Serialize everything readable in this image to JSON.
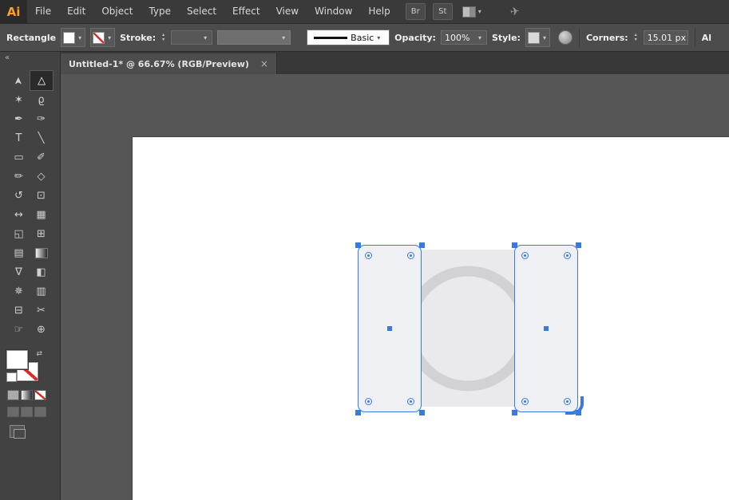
{
  "app": {
    "logo": "Ai"
  },
  "glyphs": {
    "caret": "▾",
    "stepper_up": "▴",
    "stepper_down": "▾",
    "swap": "⇄",
    "collapse": "«",
    "close": "×",
    "plane": "✈"
  },
  "menubar": {
    "items": [
      "File",
      "Edit",
      "Object",
      "Type",
      "Select",
      "Effect",
      "View",
      "Window",
      "Help"
    ],
    "brush_libraries_label": "Br",
    "graphic_styles_label": "St"
  },
  "control_bar": {
    "tool_label": "Rectangle",
    "stroke_label": "Stroke:",
    "stroke_style_value": "Basic",
    "opacity_label": "Opacity:",
    "opacity_value": "100%",
    "style_label": "Style:",
    "corners_label": "Corners:",
    "corners_value": "15.01 px",
    "right_truncated": "Al"
  },
  "document_tab": {
    "title": "Untitled-1* @ 66.67% (RGB/Preview)"
  },
  "tools": [
    {
      "name": "selection",
      "glyph": "➤",
      "cls": "up"
    },
    {
      "name": "direct-selection",
      "glyph": "▷",
      "cls": "up",
      "active": true
    },
    {
      "name": "magic-wand",
      "glyph": "✶"
    },
    {
      "name": "lasso",
      "glyph": "ϱ"
    },
    {
      "name": "pen",
      "glyph": "✒"
    },
    {
      "name": "curvature",
      "glyph": "✑"
    },
    {
      "name": "type",
      "glyph": "T"
    },
    {
      "name": "line-segment",
      "glyph": "╲"
    },
    {
      "name": "rectangle",
      "glyph": "▭"
    },
    {
      "name": "paintbrush",
      "glyph": "✐"
    },
    {
      "name": "pencil",
      "glyph": "✏"
    },
    {
      "name": "eraser",
      "glyph": "◇"
    },
    {
      "name": "rotate",
      "glyph": "↺"
    },
    {
      "name": "scale",
      "glyph": "⊡"
    },
    {
      "name": "width",
      "glyph": "↔"
    },
    {
      "name": "free-transform",
      "glyph": "▦"
    },
    {
      "name": "shape-builder",
      "glyph": "◱"
    },
    {
      "name": "perspective-grid",
      "glyph": "⊞"
    },
    {
      "name": "mesh",
      "glyph": "▤"
    },
    {
      "name": "gradient",
      "glyph": "",
      "cls": "grad"
    },
    {
      "name": "eyedropper",
      "glyph": "∇"
    },
    {
      "name": "blend",
      "glyph": "◧"
    },
    {
      "name": "symbol-sprayer",
      "glyph": "✵"
    },
    {
      "name": "column-graph",
      "glyph": "▥"
    },
    {
      "name": "artboard",
      "glyph": "⊟"
    },
    {
      "name": "slice",
      "glyph": "✂"
    },
    {
      "name": "hand",
      "glyph": "☞"
    },
    {
      "name": "zoom",
      "glyph": "⊕"
    }
  ],
  "colors": {
    "selection_blue": "#3C79DF",
    "rect_fill": "#EEF0F3",
    "middle_fill": "#EAEAEC",
    "ring_gray": "#D2D2D4",
    "artboard": "#FFFFFF",
    "canvas_bg": "#565656",
    "logo_orange": "#FF9C2A"
  }
}
